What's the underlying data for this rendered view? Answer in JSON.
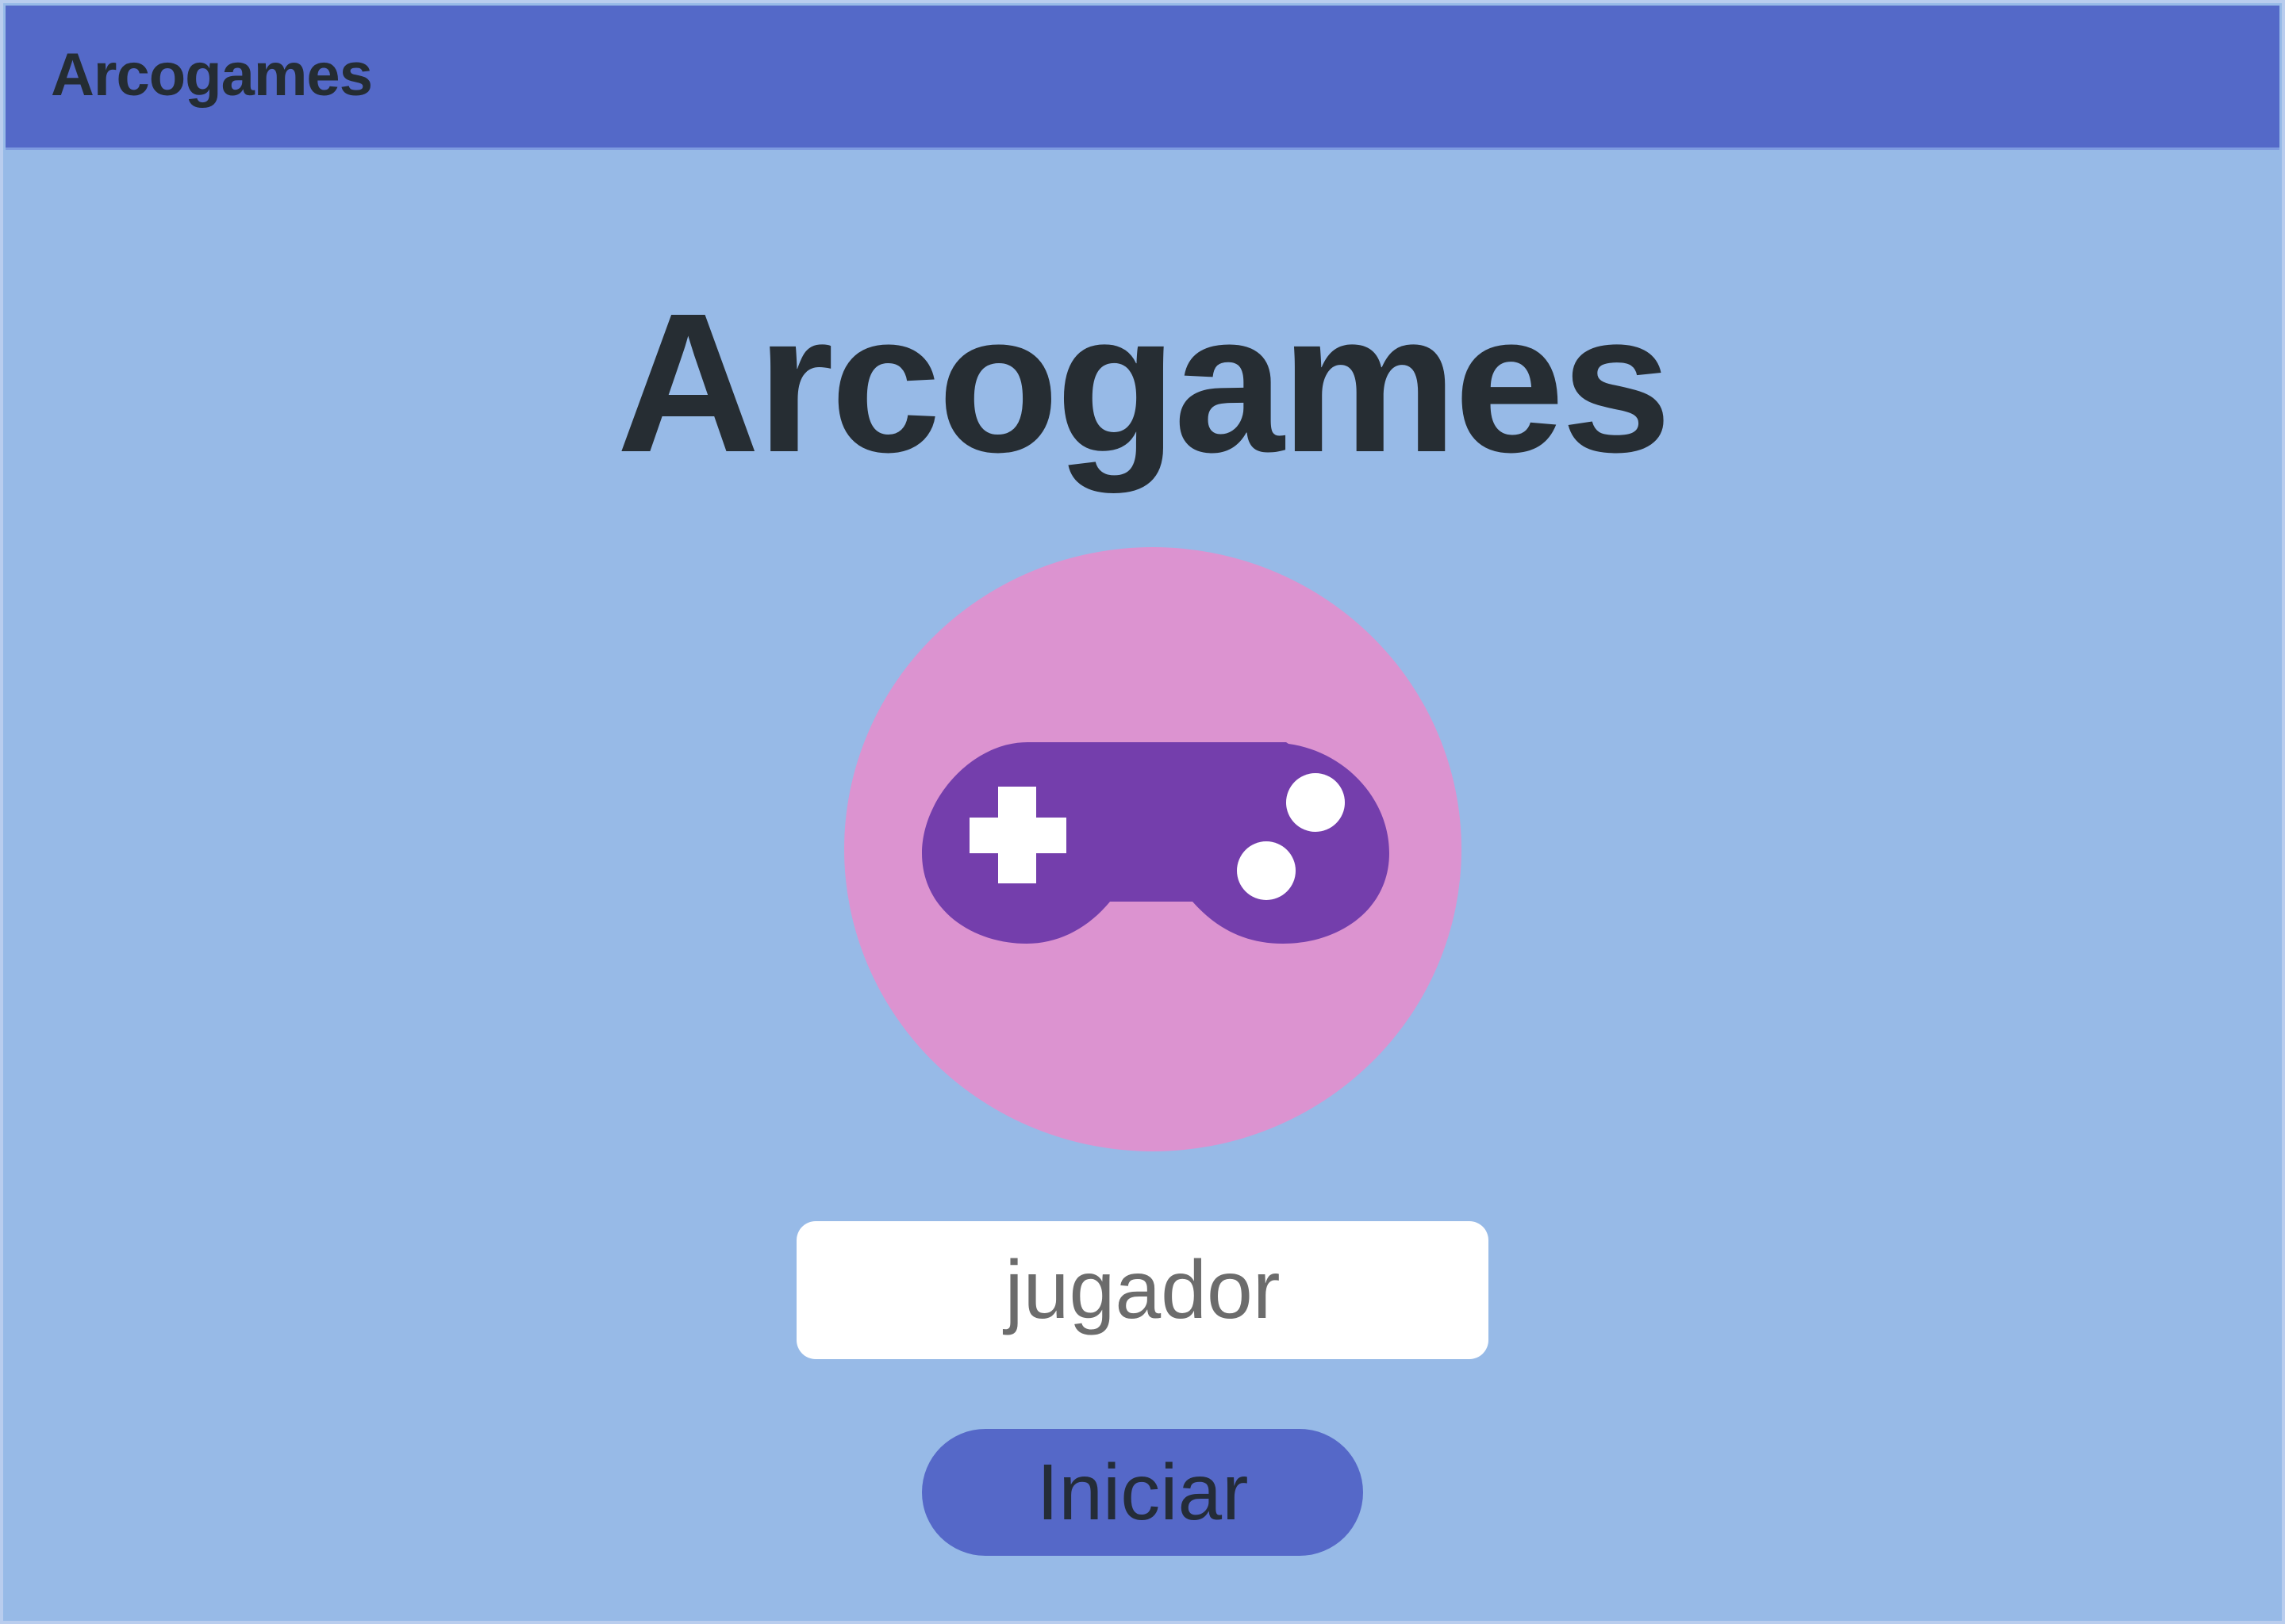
{
  "app": {
    "header_title": "Arcogames",
    "hero_title": "Arcogames"
  },
  "logo": {
    "icon": "gamepad-icon",
    "circle_color": "#dc93d0",
    "controller_color": "#743eac"
  },
  "form": {
    "name_input": {
      "value": "",
      "placeholder": "jugador"
    },
    "start_label": "Iniciar"
  },
  "colors": {
    "background": "#97bae7",
    "header": "#5469c8",
    "button": "#5568c8",
    "text": "#262d33"
  }
}
